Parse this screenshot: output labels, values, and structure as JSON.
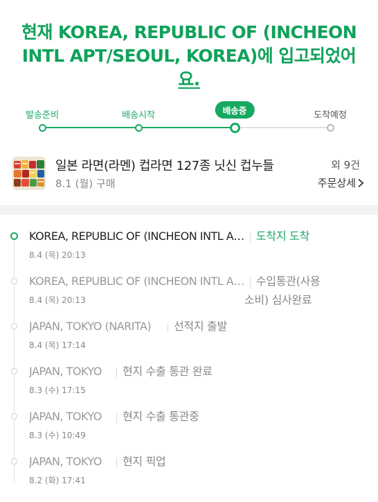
{
  "headline": {
    "prefix": "현재 KOREA, REPUBLIC OF (INCHEON INTL APT/SEOUL, KOREA)에 입고되었어",
    "last": "요."
  },
  "stepper": {
    "steps": [
      {
        "label": "발송준비",
        "state": "done"
      },
      {
        "label": "배송시작",
        "state": "done"
      },
      {
        "label": "배송중",
        "state": "current"
      },
      {
        "label": "도착예정",
        "state": "todo"
      }
    ]
  },
  "product": {
    "name": "일본 라면(라멘) 컵라면 127종 닛신 컵누들",
    "purchase_date": "8.1 (월) 구매",
    "extra_count": "외 9건",
    "detail_link": "주문상세"
  },
  "tracking": {
    "events": [
      {
        "location": "KOREA, REPUBLIC OF (INCHEON INTL APT/SEOUL, KOREA)",
        "status_line1": "도착지 도착",
        "status_line2": "",
        "time": "8.4 (목) 20:13",
        "active": true
      },
      {
        "location": "KOREA, REPUBLIC OF (INCHEON INTL APT/SEOUL, KOREA)",
        "status_line1": "수입통관(사용",
        "status_line2": "소비) 심사완료",
        "time": "8.4 (목) 20:13",
        "active": false
      },
      {
        "location": "JAPAN, TOKYO (NARITA)",
        "status_line1": "선적지 출발",
        "status_line2": "",
        "time": "8.4 (목) 17:14",
        "active": false
      },
      {
        "location": "JAPAN, TOKYO",
        "status_line1": "현지 수출 통관 완료",
        "status_line2": "",
        "time": "8.3 (수) 17:15",
        "active": false
      },
      {
        "location": "JAPAN, TOKYO",
        "status_line1": "현지 수출 통관중",
        "status_line2": "",
        "time": "8.3 (수) 10:49",
        "active": false
      },
      {
        "location": "JAPAN, TOKYO",
        "status_line1": "현지 픽업",
        "status_line2": "",
        "time": "8.2 (화) 17:41",
        "active": false
      }
    ]
  },
  "colors": {
    "accent": "#19a864",
    "headline": "#0fa25a",
    "muted": "#888888",
    "divider": "#f2f2f2"
  },
  "icons": {
    "product_thumbnail": "ramen-cups-image",
    "detail_chevron": "chevron-right-icon"
  }
}
